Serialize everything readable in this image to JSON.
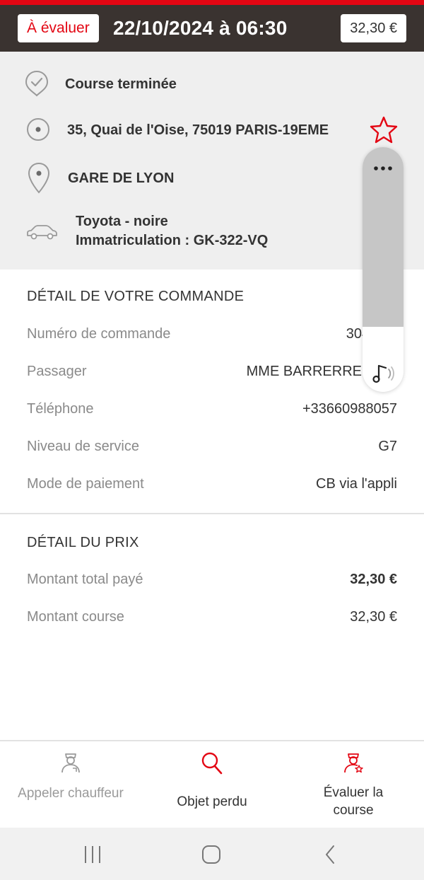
{
  "header": {
    "status_badge": "À évaluer",
    "datetime": "22/10/2024 à 06:30",
    "price_badge": "32,30 €"
  },
  "ride": {
    "status": "Course terminée",
    "pickup": "35, Quai de l'Oise, 75019 PARIS-19EME",
    "destination": "GARE DE LYON",
    "vehicle_model": "Toyota - noire",
    "vehicle_plate": "Immatriculation : GK-322-VQ"
  },
  "order": {
    "title": "DÉTAIL DE VOTRE COMMANDE",
    "rows": [
      {
        "label": "Numéro de commande",
        "value": "304 882"
      },
      {
        "label": "Passager",
        "value": "MME BARRERRE MAR"
      },
      {
        "label": "Téléphone",
        "value": "+33660988057"
      },
      {
        "label": "Niveau de service",
        "value": "G7"
      },
      {
        "label": "Mode de paiement",
        "value": "CB via l'appli"
      }
    ]
  },
  "price": {
    "title": "DÉTAIL DU PRIX",
    "rows": [
      {
        "label": "Montant total payé",
        "value": "32,30 €"
      },
      {
        "label": "Montant course",
        "value": "32,30 €"
      }
    ]
  },
  "bottom_nav": {
    "call_driver": "Appeler chauffeur",
    "lost_item": "Objet perdu",
    "rate_ride": "Évaluer la course"
  },
  "colors": {
    "accent": "#e30613",
    "header_bg": "#3a3330",
    "info_bg": "#efefef"
  },
  "icons": [
    "check-circle-icon",
    "pickup-dot-icon",
    "location-pin-icon",
    "car-icon",
    "star-icon",
    "more-dots-icon",
    "music-note-icon",
    "driver-icon",
    "search-icon",
    "driver-star-icon",
    "recent-apps-icon",
    "home-icon",
    "back-icon"
  ]
}
